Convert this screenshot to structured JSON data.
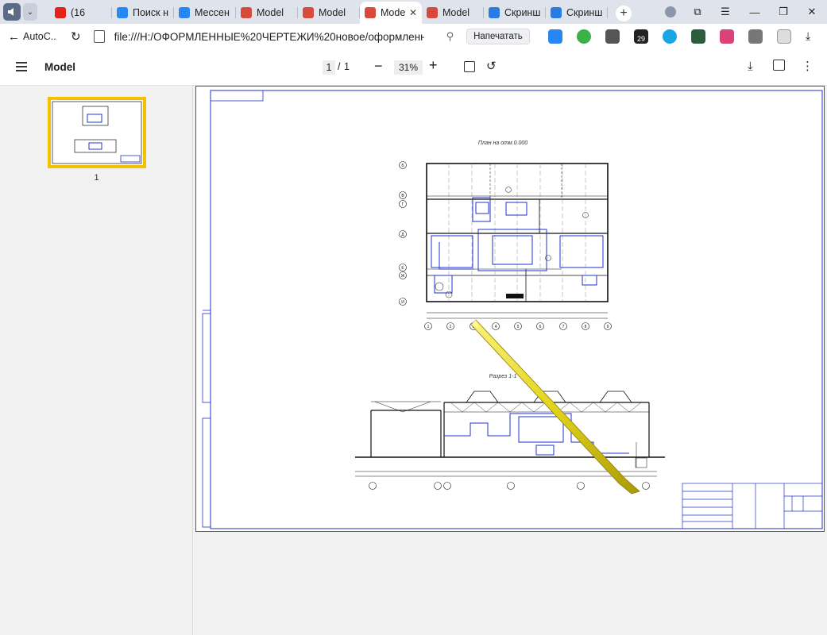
{
  "browser": {
    "tabs": [
      {
        "label": "(16",
        "icon": "youtube-icon",
        "color": "#e62117",
        "active": false
      },
      {
        "label": "Поиск н",
        "icon": "vk-icon",
        "color": "#2787f5",
        "active": false
      },
      {
        "label": "Мессен",
        "icon": "messenger-icon",
        "color": "#2787f5",
        "active": false
      },
      {
        "label": "Model",
        "icon": "pdf-icon",
        "color": "#d84a3c",
        "active": false
      },
      {
        "label": "Model",
        "icon": "pdf-icon",
        "color": "#d84a3c",
        "active": false
      },
      {
        "label": "Mode",
        "icon": "pdf-icon",
        "color": "#d84a3c",
        "active": true
      },
      {
        "label": "Model",
        "icon": "pdf-icon",
        "color": "#d84a3c",
        "active": false
      },
      {
        "label": "Скринш",
        "icon": "screenshot-icon",
        "color": "#2a7be4",
        "active": false
      },
      {
        "label": "Скринш",
        "icon": "screenshot-icon",
        "color": "#2a7be4",
        "active": false
      }
    ],
    "new_tab": "+",
    "back_label": "AutoC...",
    "url": "file:///H:/ОФОРМЛЕННЫЕ%20ЧЕРТЕЖИ%20новое/оформленн...",
    "print_button": "Напечатать",
    "ext_badge": "29"
  },
  "pdf": {
    "title": "Model",
    "page_current": "1",
    "page_sep": "/",
    "page_total": "1",
    "zoom": "31%",
    "thumbnail_label": "1"
  },
  "drawing": {
    "plan_title": "План на отм.0.000",
    "section_title": "Разрез 1-1",
    "row_axes": [
      "Б",
      "В",
      "Г",
      "Д",
      "Е",
      "Ж",
      "И"
    ],
    "col_axes": [
      "1",
      "2",
      "3",
      "4",
      "5",
      "6",
      "7",
      "8",
      "9"
    ]
  },
  "colors": {
    "accent_yellow": "#f2c200",
    "drawing_blue": "#2233cc",
    "drawing_black": "#111111"
  }
}
